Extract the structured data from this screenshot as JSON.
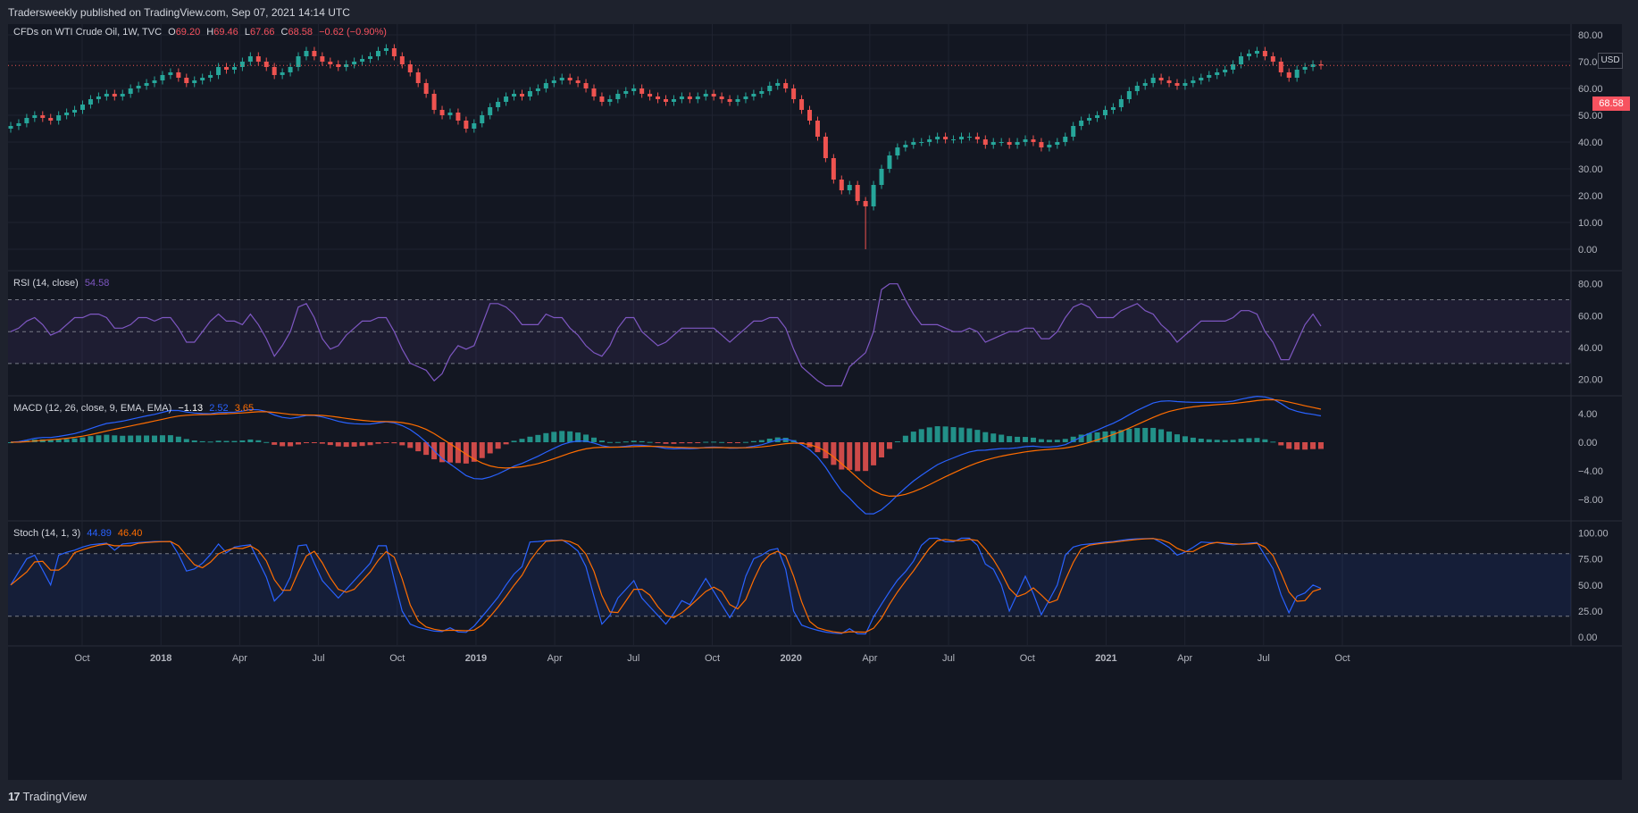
{
  "header": {
    "publish_text": "Tradersweekly published on TradingView.com, Sep 07, 2021 14:14 UTC"
  },
  "footer": {
    "brand": "TradingView",
    "logo_mark": "17"
  },
  "theme": {
    "up": "#26a69a",
    "down": "#ef5350",
    "rsi": "#7e57c2",
    "macd": "#2962ff",
    "signal": "#ff6d00",
    "bg": "#131722"
  },
  "chart_data": [
    {
      "type": "candlestick",
      "symbol": "CFDs on WTI Crude Oil, 1W, TVC",
      "ohlc_labels": {
        "O": "69.20",
        "H": "69.46",
        "L": "67.66",
        "C": "68.58",
        "chg": "−0.62 (−0.90%)"
      },
      "currency": "USD",
      "last_price": "68.58",
      "y_ticks": [
        "0.00",
        "10.00",
        "20.00",
        "30.00",
        "40.00",
        "50.00",
        "60.00",
        "70.00",
        "80.00"
      ],
      "ylim": [
        0,
        80
      ],
      "x_ticks": [
        "Oct",
        "2018",
        "Apr",
        "Jul",
        "Oct",
        "2019",
        "Apr",
        "Jul",
        "Oct",
        "2020",
        "Apr",
        "Jul",
        "Oct",
        "2021",
        "Apr",
        "Jul",
        "Oct"
      ],
      "closes": [
        46,
        47,
        49,
        50,
        49,
        48,
        50,
        51,
        52,
        54,
        56,
        57,
        58,
        57,
        58,
        60,
        61,
        62,
        63,
        65,
        66,
        64,
        62,
        63,
        64,
        65,
        68,
        67,
        68,
        70,
        72,
        70,
        68,
        65,
        66,
        68,
        72,
        74,
        72,
        70,
        69,
        68,
        69,
        70,
        71,
        72,
        74,
        75,
        72,
        69,
        66,
        62,
        58,
        52,
        50,
        51,
        48,
        45,
        47,
        50,
        53,
        55,
        57,
        58,
        57,
        59,
        60,
        62,
        63,
        64,
        63,
        62,
        60,
        57,
        55,
        56,
        58,
        59,
        60,
        58,
        57,
        56,
        55,
        56,
        57,
        56,
        57,
        58,
        57,
        56,
        55,
        56,
        57,
        58,
        59,
        61,
        62,
        60,
        56,
        52,
        48,
        42,
        34,
        26,
        22,
        24,
        18,
        16,
        24,
        30,
        35,
        38,
        39,
        40,
        40,
        41,
        42,
        41,
        41,
        42,
        42,
        41,
        39,
        40,
        40,
        39,
        40,
        41,
        40,
        38,
        39,
        40,
        42,
        46,
        48,
        49,
        50,
        52,
        53,
        56,
        59,
        61,
        62,
        64,
        63,
        62,
        61,
        62,
        63,
        64,
        65,
        66,
        67,
        69,
        72,
        73,
        74,
        72,
        70,
        66,
        64,
        67,
        68,
        69,
        68.58
      ],
      "series_note": "weekly closes, approximate"
    },
    {
      "type": "line",
      "title": "RSI (14, close)",
      "last_value": "54.58",
      "y_ticks": [
        "20.00",
        "40.00",
        "60.00",
        "80.00"
      ],
      "ylim": [
        12,
        86
      ],
      "bands": [
        30,
        50,
        70
      ]
    },
    {
      "type": "line+histogram",
      "title": "MACD (12, 26, close, 9, EMA, EMA)",
      "values": {
        "histogram": "−1.13",
        "macd": "2.52",
        "signal": "3.65"
      },
      "y_ticks": [
        "−8.00",
        "−4.00",
        "0.00",
        "4.00"
      ],
      "ylim": [
        -10.5,
        6
      ]
    },
    {
      "type": "line",
      "title": "Stoch (14, 1, 3)",
      "values": {
        "k": "44.89",
        "d": "46.40"
      },
      "y_ticks": [
        "0.00",
        "25.00",
        "50.00",
        "75.00",
        "100.00"
      ],
      "ylim": [
        -5,
        108
      ],
      "bands": [
        20,
        80
      ]
    }
  ]
}
